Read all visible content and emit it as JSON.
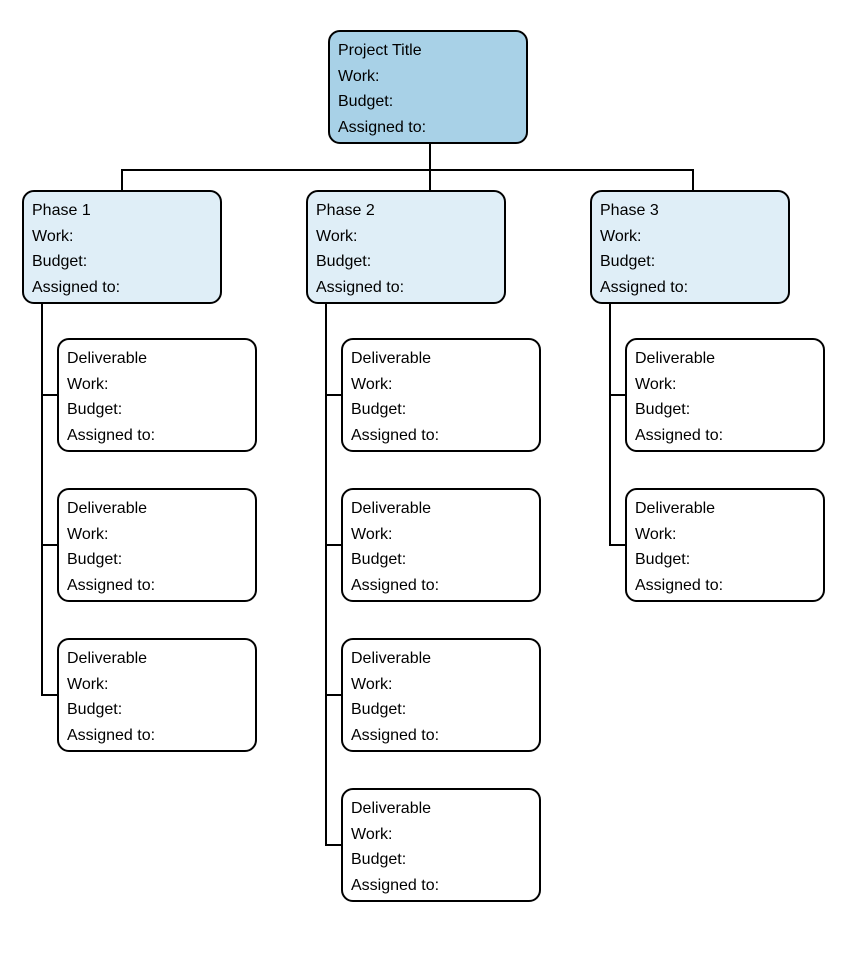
{
  "labels": {
    "work": "Work:",
    "budget": "Budget:",
    "assigned": "Assigned to:"
  },
  "root": {
    "title": "Project Title",
    "work": "",
    "budget": "",
    "assigned": ""
  },
  "phases": [
    {
      "title": "Phase 1",
      "work": "",
      "budget": "",
      "assigned": "",
      "deliverables": [
        {
          "title": "Deliverable",
          "work": "",
          "budget": "",
          "assigned": ""
        },
        {
          "title": "Deliverable",
          "work": "",
          "budget": "",
          "assigned": ""
        },
        {
          "title": "Deliverable",
          "work": "",
          "budget": "",
          "assigned": ""
        }
      ]
    },
    {
      "title": "Phase 2",
      "work": "",
      "budget": "",
      "assigned": "",
      "deliverables": [
        {
          "title": "Deliverable",
          "work": "",
          "budget": "",
          "assigned": ""
        },
        {
          "title": "Deliverable",
          "work": "",
          "budget": "",
          "assigned": ""
        },
        {
          "title": "Deliverable",
          "work": "",
          "budget": "",
          "assigned": ""
        },
        {
          "title": "Deliverable",
          "work": "",
          "budget": "",
          "assigned": ""
        }
      ]
    },
    {
      "title": "Phase 3",
      "work": "",
      "budget": "",
      "assigned": "",
      "deliverables": [
        {
          "title": "Deliverable",
          "work": "",
          "budget": "",
          "assigned": ""
        },
        {
          "title": "Deliverable",
          "work": "",
          "budget": "",
          "assigned": ""
        }
      ]
    }
  ],
  "colors": {
    "root_bg": "#a8d1e7",
    "phase_bg": "#dfeef7",
    "deliverable_bg": "#ffffff",
    "border": "#000000"
  }
}
